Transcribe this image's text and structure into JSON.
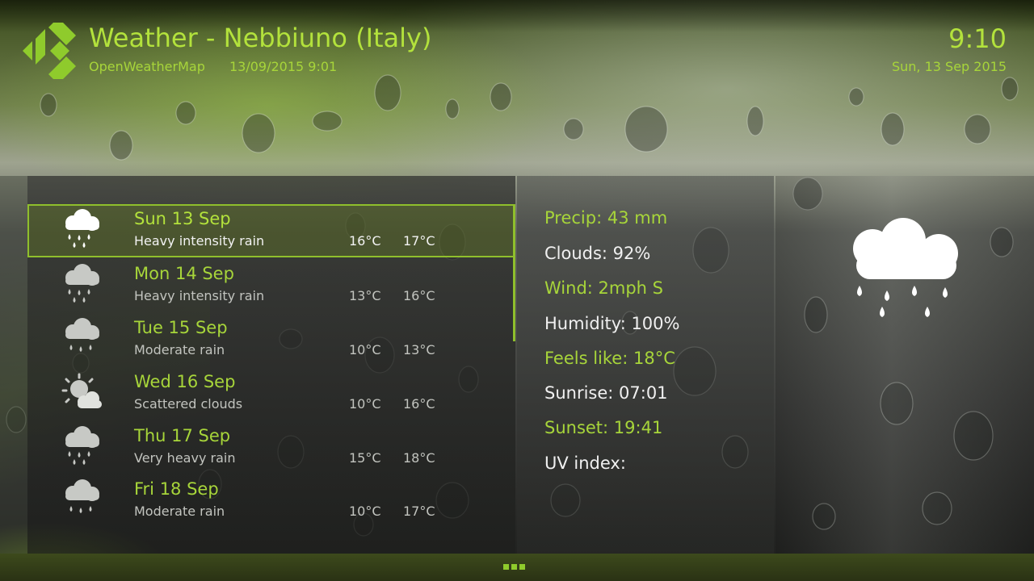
{
  "header": {
    "title": "Weather - Nebbiuno (Italy)",
    "provider": "OpenWeatherMap",
    "updated": "13/09/2015 9:01",
    "time": "9:10",
    "date": "Sun, 13 Sep 2015"
  },
  "forecast": [
    {
      "day": "Sun 13 Sep",
      "desc": "Heavy intensity rain",
      "low": "16°C",
      "high": "17°C",
      "icon": "rain-cloud-icon"
    },
    {
      "day": "Mon 14 Sep",
      "desc": "Heavy intensity rain",
      "low": "13°C",
      "high": "16°C",
      "icon": "rain-cloud-icon"
    },
    {
      "day": "Tue 15 Sep",
      "desc": "Moderate rain",
      "low": "10°C",
      "high": "13°C",
      "icon": "rain-cloud-icon"
    },
    {
      "day": "Wed 16 Sep",
      "desc": "Scattered clouds",
      "low": "10°C",
      "high": "16°C",
      "icon": "sun-behind-cloud-icon"
    },
    {
      "day": "Thu 17 Sep",
      "desc": "Very heavy rain",
      "low": "15°C",
      "high": "18°C",
      "icon": "rain-cloud-icon"
    },
    {
      "day": "Fri 18 Sep",
      "desc": "Moderate rain",
      "low": "10°C",
      "high": "17°C",
      "icon": "rain-cloud-icon"
    }
  ],
  "details": {
    "precip": "Precip: 43 mm",
    "clouds": "Clouds: 92%",
    "wind": "Wind: 2mph S",
    "humidity": "Humidity: 100%",
    "feels_like": "Feels like: 18°C",
    "sunrise": "Sunrise: 07:01",
    "sunset": "Sunset: 19:41",
    "uv": "UV index:"
  },
  "colors": {
    "accent": "#b3e23c",
    "accent_dim": "#a7d53a",
    "selection_border": "#8fbf2c"
  },
  "current_icon": "rain-cloud-icon"
}
